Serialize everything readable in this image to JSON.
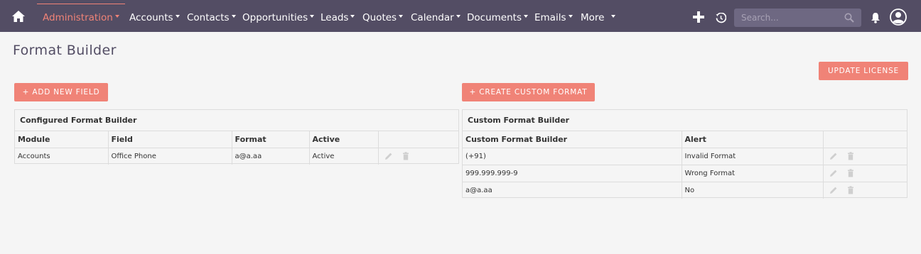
{
  "nav": {
    "items": [
      {
        "label": "Administration"
      },
      {
        "label": "Accounts"
      },
      {
        "label": "Contacts"
      },
      {
        "label": "Opportunities"
      },
      {
        "label": "Leads"
      },
      {
        "label": "Quotes"
      },
      {
        "label": "Calendar"
      },
      {
        "label": "Documents"
      },
      {
        "label": "Emails"
      },
      {
        "label": "More"
      }
    ],
    "search_placeholder": "Search..."
  },
  "page": {
    "title": "Format Builder",
    "update_license": "UPDATE LICENSE",
    "add_new_field": "+ ADD NEW FIELD",
    "create_custom_format": "+ CREATE CUSTOM FORMAT"
  },
  "configured": {
    "heading": "Configured Format Builder",
    "columns": [
      "Module",
      "Field",
      "Format",
      "Active"
    ],
    "rows": [
      {
        "module": "Accounts",
        "field": "Office Phone",
        "format": "a@a.aa",
        "active": "Active"
      }
    ]
  },
  "custom": {
    "heading": "Custom Format Builder",
    "columns": [
      "Custom Format Builder",
      "Alert"
    ],
    "rows": [
      {
        "format": "(+91)",
        "alert": "Invalid Format"
      },
      {
        "format": "999.999.999-9",
        "alert": "Wrong Format"
      },
      {
        "format": "a@a.aa",
        "alert": "No"
      }
    ]
  },
  "colors": {
    "navbar": "#534d64",
    "accent": "#f08377",
    "background": "#f5f5f5"
  }
}
